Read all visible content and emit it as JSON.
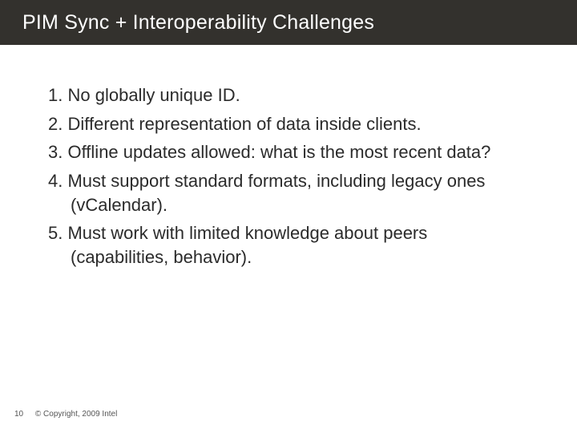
{
  "header": {
    "title": "PIM Sync + Interoperability Challenges"
  },
  "body": {
    "points": [
      "No globally unique ID.",
      "Different representation of data inside clients.",
      "Offline updates allowed: what is the most recent data?",
      "Must support standard formats, including legacy ones  (vCalendar).",
      "Must work with limited knowledge about peers (capabilities, behavior)."
    ]
  },
  "footer": {
    "page_number": "10",
    "copyright": "© Copyright, 2009 Intel"
  }
}
